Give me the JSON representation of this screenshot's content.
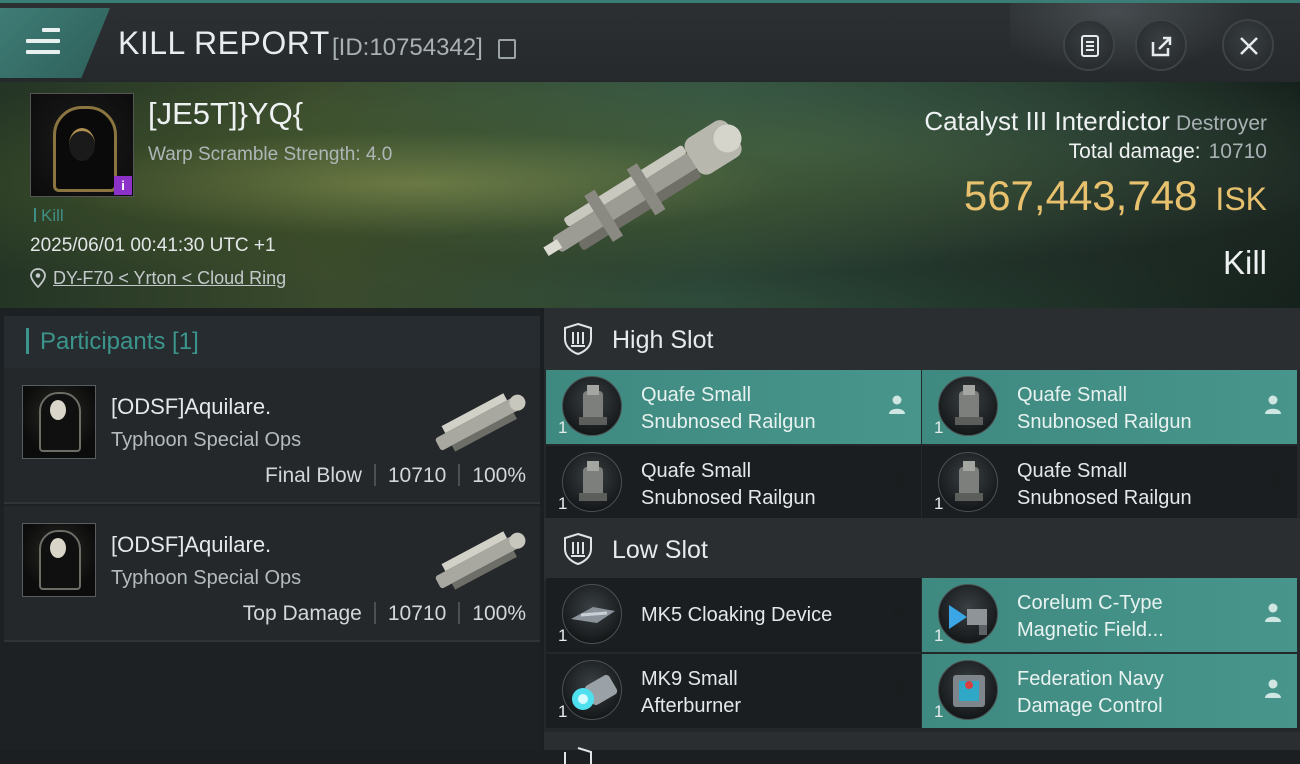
{
  "header": {
    "title": "KILL REPORT",
    "report_id": "[ID:10754342]",
    "icons": [
      "menu-icon",
      "copy-icon",
      "clipboard-icon",
      "share-icon",
      "close-icon"
    ]
  },
  "victim": {
    "name": "[JE5T]}YQ{",
    "warp_scramble": "Warp Scramble Strength: 4.0",
    "badge": "i",
    "tag": "Kill",
    "datetime": "2025/06/01 00:41:30 UTC +1",
    "location": "DY-F70 < Yrton < Cloud Ring",
    "ship_name": "Catalyst III Interdictor",
    "ship_class": "Destroyer",
    "total_damage_label": "Total damage:",
    "total_damage_value": "10710",
    "isk_value": "567,443,748",
    "isk_unit": "ISK",
    "result": "Kill"
  },
  "participants": {
    "label": "Participants [1]",
    "items": [
      {
        "name": "[ODSF]Aquilare.",
        "ship": "Typhoon Special Ops",
        "role": "Final Blow",
        "damage": "10710",
        "percent": "100%"
      },
      {
        "name": "[ODSF]Aquilare.",
        "ship": "Typhoon Special Ops",
        "role": "Top Damage",
        "damage": "10710",
        "percent": "100%"
      }
    ]
  },
  "slots": {
    "high": {
      "label": "High Slot",
      "modules": [
        {
          "name_l1": "Quafe Small",
          "name_l2": "Snubnosed Railgun",
          "qty": "1",
          "state": "pilot-icon"
        },
        {
          "name_l1": "Quafe Small",
          "name_l2": "Snubnosed Railgun",
          "qty": "1",
          "state": "pilot-icon"
        },
        {
          "name_l1": "Quafe Small",
          "name_l2": "Snubnosed Railgun",
          "qty": "1",
          "state": "destroyed-icon"
        },
        {
          "name_l1": "Quafe Small",
          "name_l2": "Snubnosed Railgun",
          "qty": "1",
          "state": "destroyed-icon"
        }
      ]
    },
    "low": {
      "label": "Low Slot",
      "modules": [
        {
          "name_l1": "MK5 Cloaking Device",
          "name_l2": "",
          "qty": "1",
          "state": "destroyed-icon"
        },
        {
          "name_l1": "Corelum C-Type",
          "name_l2": "Magnetic Field...",
          "qty": "1",
          "state": "pilot-icon"
        },
        {
          "name_l1": "MK9 Small",
          "name_l2": "Afterburner",
          "qty": "1",
          "state": "destroyed-icon"
        },
        {
          "name_l1": "Federation Navy",
          "name_l2": "Damage Control",
          "qty": "1",
          "state": "pilot-icon"
        }
      ]
    }
  },
  "colors": {
    "accent": "#3c958b",
    "isk": "#e7c16d",
    "purple_badge": "#8d32c9"
  }
}
